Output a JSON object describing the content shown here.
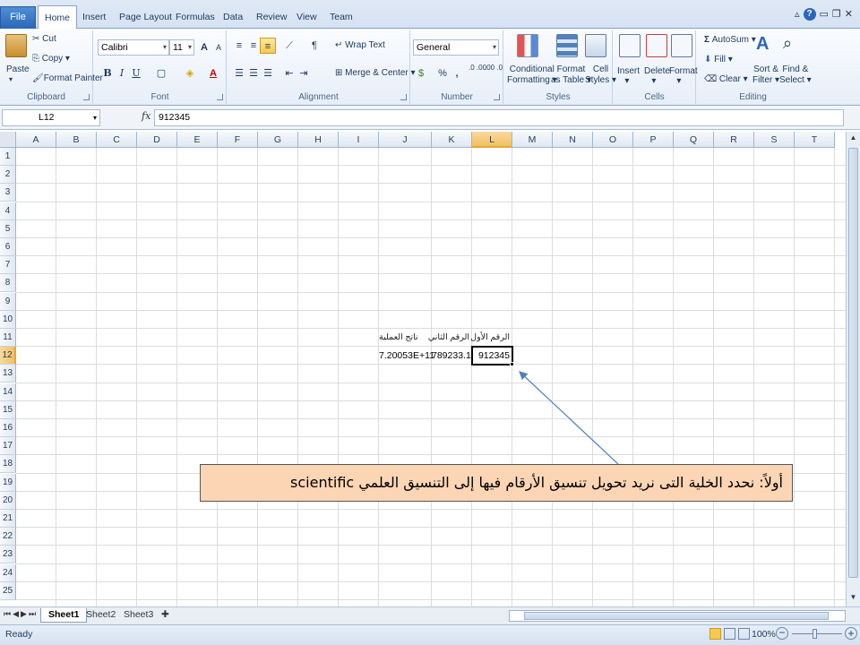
{
  "ribbon_tabs": {
    "file": "File",
    "home": "Home",
    "insert": "Insert",
    "page_layout": "Page Layout",
    "formulas": "Formulas",
    "data": "Data",
    "review": "Review",
    "view": "View",
    "team": "Team"
  },
  "clipboard": {
    "paste": "Paste",
    "cut": "Cut",
    "copy": "Copy",
    "format_painter": "Format Painter",
    "label": "Clipboard"
  },
  "font": {
    "name": "Calibri",
    "size": "11",
    "bold": "B",
    "italic": "I",
    "underline": "U",
    "grow": "A",
    "shrink": "A",
    "label": "Font"
  },
  "alignment": {
    "wrap_text": "Wrap Text",
    "merge_center": "Merge & Center",
    "label": "Alignment"
  },
  "number": {
    "format": "General",
    "currency": "$",
    "percent": "%",
    "comma": ",",
    "inc_decimal": ".0 .00",
    "dec_decimal": ".00 .0",
    "label": "Number"
  },
  "styles": {
    "conditional_formatting_1": "Conditional",
    "conditional_formatting_2": "Formatting",
    "format_table_1": "Format",
    "format_table_2": "as Table",
    "cell_styles_1": "Cell",
    "cell_styles_2": "Styles",
    "label": "Styles"
  },
  "cells": {
    "insert": "Insert",
    "delete": "Delete",
    "format": "Format",
    "label": "Cells"
  },
  "editing": {
    "autosum": "AutoSum",
    "fill": "Fill",
    "clear": "Clear",
    "sort_filter_1": "Sort &",
    "sort_filter_2": "Filter",
    "find_select_1": "Find &",
    "find_select_2": "Select",
    "label": "Editing"
  },
  "formula_bar": {
    "name_box": "L12",
    "fx": "fx",
    "value": "912345"
  },
  "columns": [
    "A",
    "B",
    "C",
    "D",
    "E",
    "F",
    "G",
    "H",
    "I",
    "J",
    "K",
    "L",
    "M",
    "N",
    "O",
    "P",
    "Q",
    "R",
    "S",
    "T"
  ],
  "selected_column": "L",
  "rows": [
    "1",
    "2",
    "3",
    "4",
    "5",
    "6",
    "7",
    "8",
    "9",
    "10",
    "11",
    "12",
    "13",
    "14",
    "15",
    "16",
    "17",
    "18",
    "19",
    "20",
    "21",
    "22",
    "23",
    "24",
    "25"
  ],
  "selected_row": "12",
  "cells_data": {
    "L11": "الرقم الأول",
    "K11": "الرقم الثاني",
    "J11": "ناتج العملية",
    "L12": "912345",
    "K12": "789233.1",
    "J12": "7.20053E+11"
  },
  "sheets": [
    "Sheet1",
    "Sheet2",
    "Sheet3"
  ],
  "active_sheet": "Sheet1",
  "status": {
    "ready": "Ready",
    "zoom": "100%"
  },
  "callout": {
    "text": "أولاً: نحدد الخلية التى نريد تحويل تنسيق الأرقام فيها إلى التنسيق العلمي  scientific"
  },
  "colors": {
    "selection_header": "#f1c15f",
    "callout_fill": "#fcd5b5",
    "arrow": "#4f81bd"
  }
}
